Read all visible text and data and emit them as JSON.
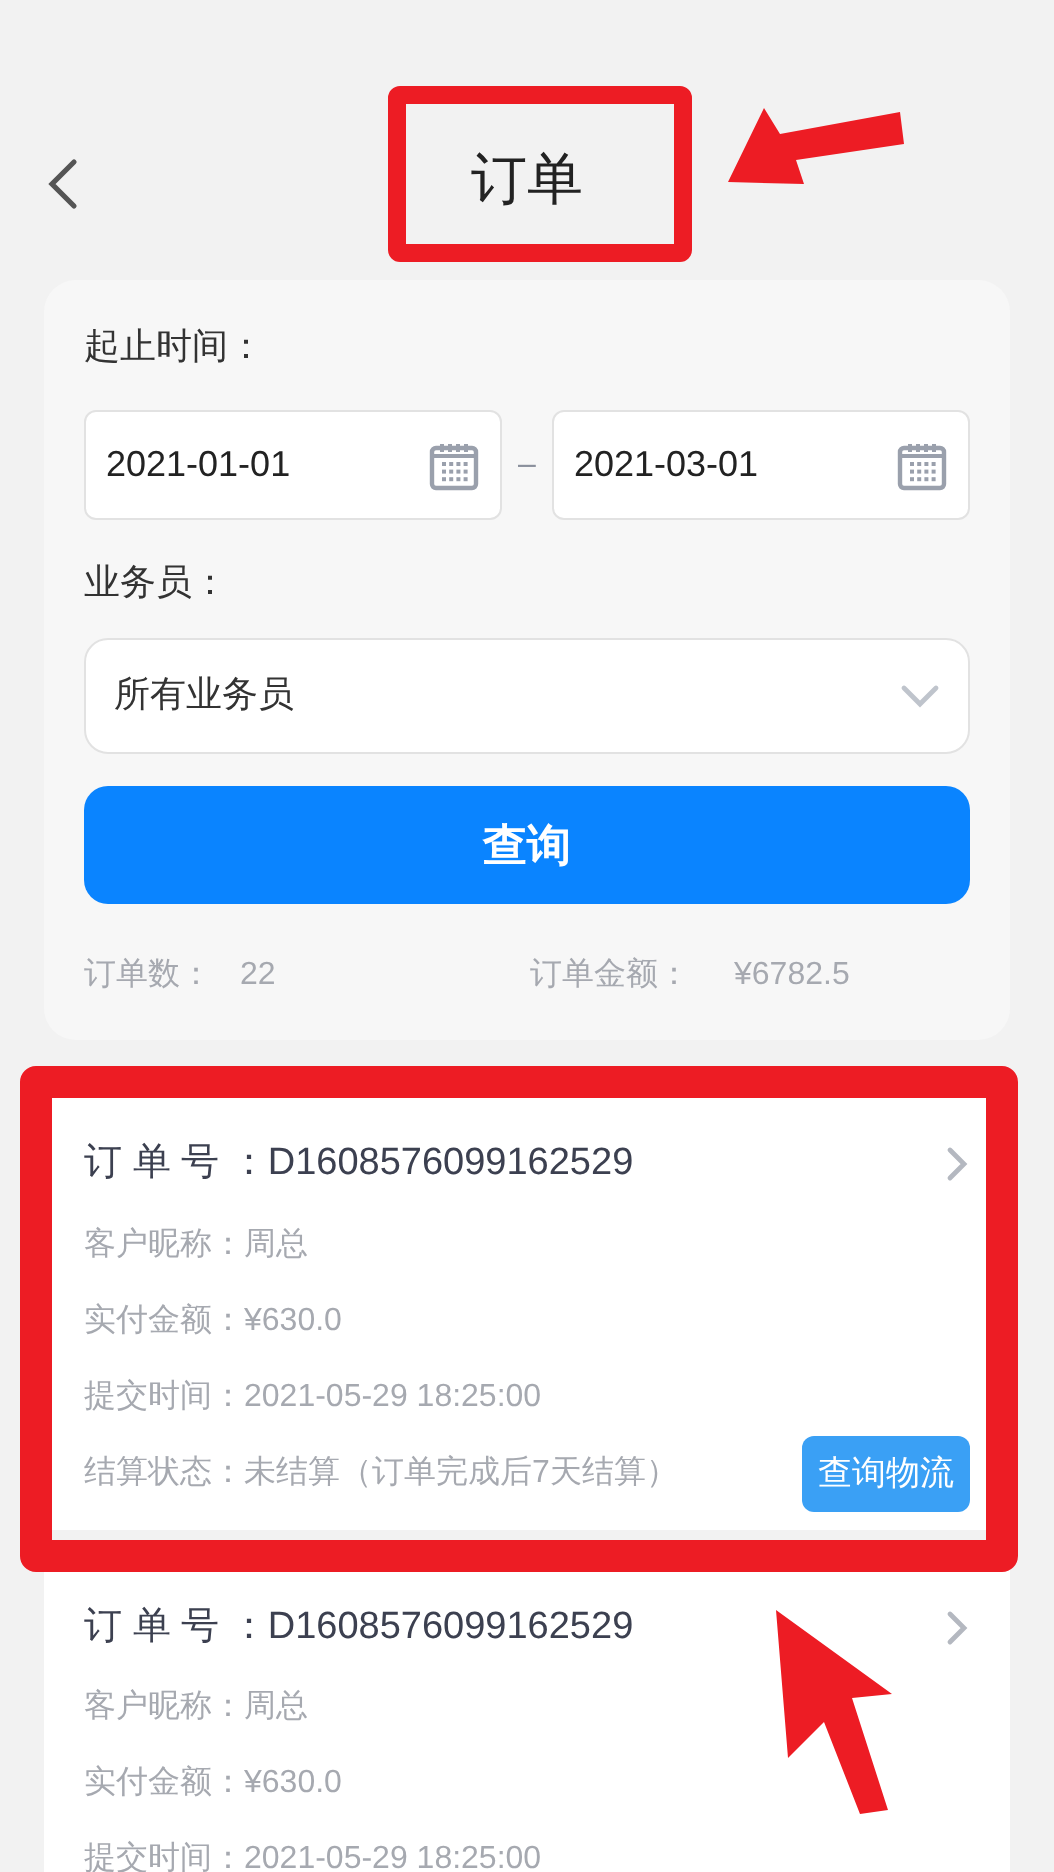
{
  "header": {
    "title": "订单"
  },
  "filter": {
    "date_label": "起止时间：",
    "start_date": "2021-01-01",
    "separator": "–",
    "end_date": "2021-03-01",
    "staff_label": "业务员：",
    "staff_value": "所有业务员",
    "query_button": "查询",
    "order_count_label": "订单数：",
    "order_count": "22",
    "order_amount_label": "订单金额：",
    "order_amount": "¥6782.5"
  },
  "orders": [
    {
      "order_no_label": "订 单 号 ：",
      "order_no": "D1608576099162529",
      "fields": [
        {
          "label": "客户昵称：",
          "value": "周总"
        },
        {
          "label": "实付金额：",
          "value": "¥630.0"
        },
        {
          "label": "提交时间：",
          "value": "2021-05-29 18:25:00"
        },
        {
          "label": "结算状态：",
          "value": "未结算（订单完成后7天结算）"
        }
      ],
      "logistics_button": "查询物流"
    },
    {
      "order_no_label": "订 单 号 ：",
      "order_no": "D1608576099162529",
      "fields": [
        {
          "label": "客户昵称：",
          "value": "周总"
        },
        {
          "label": "实付金额：",
          "value": "¥630.0"
        },
        {
          "label": "提交时间：",
          "value": "2021-05-29 18:25:00"
        }
      ]
    }
  ]
}
